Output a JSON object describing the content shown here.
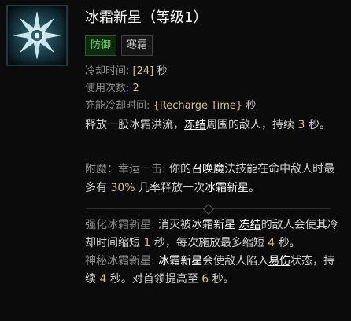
{
  "skill": {
    "title": "冰霜新星（等级1）",
    "tags": [
      "防御",
      "寒霜"
    ],
    "stats": [
      {
        "label": "冷却时间: ",
        "value": "[24]",
        "suffix": " 秒"
      },
      {
        "label": "使用次数: ",
        "value": "2",
        "suffix": ""
      },
      {
        "label": "充能冷却时间: ",
        "value": "{Recharge Time}",
        "suffix": " 秒"
      }
    ],
    "description": {
      "p1": "释放一股冰霜洪流，",
      "freeze": "冻结",
      "p2": "周围的敌人，持续 ",
      "duration": "3",
      "p3": " 秒。"
    }
  },
  "enchant": {
    "label": "附魔：幸运一击: ",
    "p1": "你的",
    "summon": "召唤魔法",
    "p2": "技能在命中敌人时最多有 ",
    "chance": "30%",
    "p3": " 几率释放一次",
    "skill_name": "冰霜新星",
    "p4": "。"
  },
  "upgrades": [
    {
      "name": "强化冰霜新星: ",
      "p1": "消灭被",
      "ref": "冰霜新星",
      "freeze": "冻结",
      "p2": "的敌人会使其冷却时间缩短 ",
      "n1": "1",
      "p3": " 秒，每次施放最多缩短 ",
      "n2": "4",
      "p4": " 秒。"
    },
    {
      "name": "神秘冰霜新星: ",
      "ref": "冰霜新星",
      "p1": "会使敌人陷入",
      "vuln": "易伤",
      "p2": "状态，持续 ",
      "n1": "4",
      "p3": " 秒。对首领提高至 ",
      "n2": "6",
      "p4": " 秒。"
    }
  ],
  "icon_name": "frost-nova-snowflake-icon",
  "colors": {
    "value_gold": "#e0c35a",
    "defense_green": "#5fd36d"
  }
}
